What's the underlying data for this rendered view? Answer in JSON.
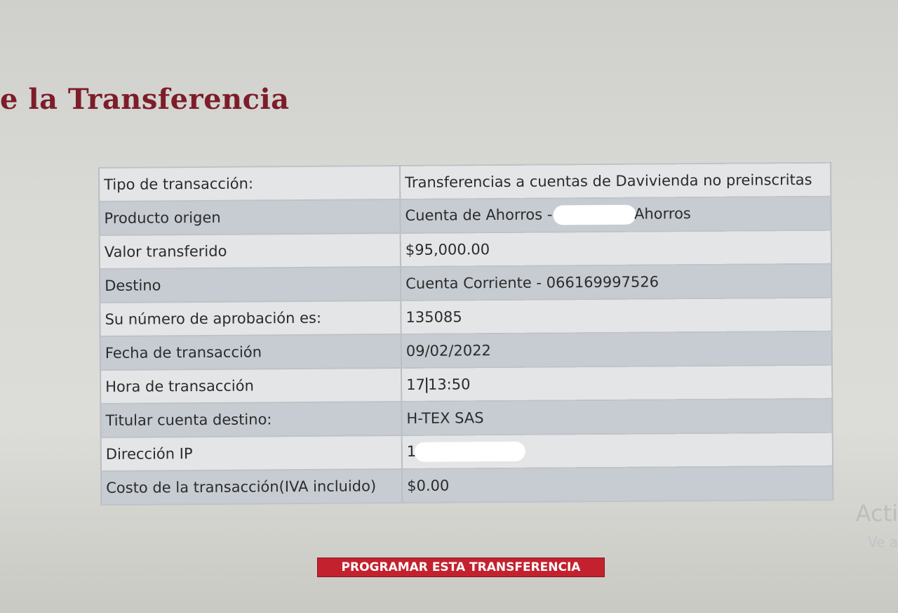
{
  "page": {
    "title": "e la Transferencia",
    "colors": {
      "title": "#7d1d2a",
      "button_bg": "#c4212e",
      "row_light": "#e4e5e6",
      "row_dark": "#c7ccd3"
    }
  },
  "details": [
    {
      "label": "Tipo de transacción:",
      "value": "Transferencias a cuentas de Davivienda no preinscritas"
    },
    {
      "label": "Producto origen",
      "value_prefix": "Cuenta de Ahorros - ",
      "value_suffix": "Ahorros",
      "redacted": true
    },
    {
      "label": "Valor transferido",
      "value": "$95,000.00"
    },
    {
      "label": "Destino",
      "value": "Cuenta Corriente - 066169997526"
    },
    {
      "label": "Su número de aprobación es:",
      "value": "135085"
    },
    {
      "label": "Fecha de transacción",
      "value": "09/02/2022"
    },
    {
      "label": "Hora de transacción",
      "value_prefix": "17",
      "value_suffix": "13:50"
    },
    {
      "label": "Titular cuenta destino:",
      "value": "H-TEX SAS"
    },
    {
      "label": "Dirección IP",
      "value_prefix": "1",
      "redacted": true
    },
    {
      "label": "Costo de la transacción(IVA incluido)",
      "value": "$0.00"
    }
  ],
  "actions": {
    "schedule_label": "PROGRAMAR ESTA TRANSFERENCIA"
  },
  "watermark": {
    "line1": "Acti",
    "line2": "Ve a"
  }
}
